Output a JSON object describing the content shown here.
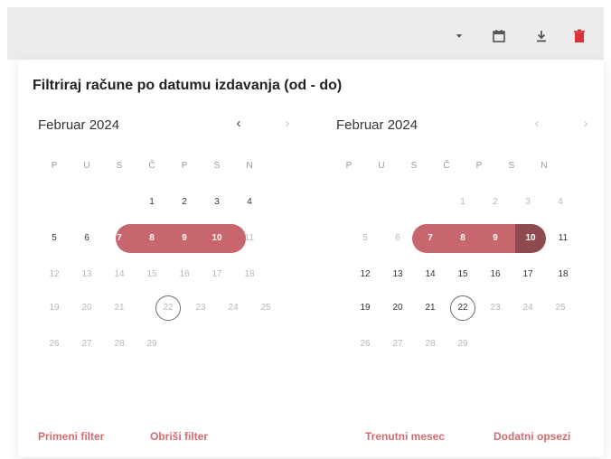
{
  "title": "Filtriraj račune po datumu izdavanja (od - do)",
  "toolbar": {
    "dropdown_icon": "caret-down-icon",
    "calendar_icon": "calendar-icon",
    "download_icon": "download-icon",
    "delete_icon": "trash-icon"
  },
  "left_calendar": {
    "month": "Februar 2024",
    "prev": "‹",
    "next": "›",
    "weekdays": [
      "P",
      "U",
      "S",
      "Č",
      "P",
      "S",
      "N"
    ],
    "weeks": [
      [
        "",
        "",
        "",
        "1",
        "2",
        "3",
        "4"
      ],
      [
        "5",
        "6",
        "7",
        "8",
        "9",
        "10",
        "11"
      ],
      [
        "12",
        "13",
        "14",
        "15",
        "16",
        "17",
        "18"
      ],
      [
        "19",
        "20",
        "21",
        "22",
        "23",
        "24",
        "25"
      ],
      [
        "26",
        "27",
        "28",
        "29",
        "",
        "",
        ""
      ]
    ]
  },
  "right_calendar": {
    "month": "Februar 2024",
    "prev": "‹",
    "next": "›",
    "weekdays": [
      "P",
      "U",
      "S",
      "Č",
      "P",
      "S",
      "N"
    ],
    "weeks": [
      [
        "",
        "",
        "",
        "1",
        "2",
        "3",
        "4"
      ],
      [
        "5",
        "6",
        "7",
        "8",
        "9",
        "10",
        "11"
      ],
      [
        "12",
        "13",
        "14",
        "15",
        "16",
        "17",
        "18"
      ],
      [
        "19",
        "20",
        "21",
        "22",
        "23",
        "24",
        "25"
      ],
      [
        "26",
        "27",
        "28",
        "29",
        "",
        "",
        ""
      ]
    ]
  },
  "buttons": {
    "apply": "Primeni filter",
    "clear": "Obriši filter",
    "current_month": "Trenutni mesec",
    "more_ranges": "Dodatni opsezi"
  },
  "colors": {
    "range": "#c7676d",
    "range_end": "#8f4a4d",
    "accent_text": "#d46b70",
    "delete": "#d9343b"
  }
}
